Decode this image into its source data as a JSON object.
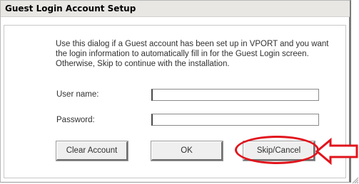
{
  "dialog": {
    "title": "Guest Login Account Setup",
    "description": "Use this dialog if a Guest account has been set up in VPORT and you want the login information to automatically fill in for the Guest Login screen. Otherwise, Skip to continue with the installation.",
    "fields": {
      "username_label": "User name:",
      "username_value": "",
      "password_label": "Password:",
      "password_value": ""
    },
    "buttons": {
      "clear": "Clear Account",
      "ok": "OK",
      "skip": "Skip/Cancel"
    }
  },
  "annotation": {
    "color": "#e1141c",
    "highlight": "ellipse around Skip/Cancel",
    "pointer": "arrow-left-icon"
  }
}
